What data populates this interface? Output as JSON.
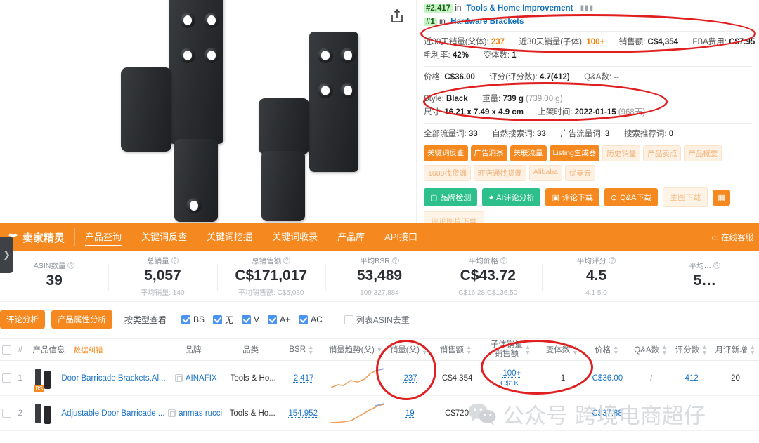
{
  "product_panel": {
    "share_icon": "share-icon",
    "rank_main": {
      "badge": "#2,417",
      "prefix": "in",
      "category": "Tools & Home Improvement"
    },
    "rank_sub": {
      "badge": "#1",
      "prefix": "in",
      "category": "Hardware Brackets"
    },
    "metrics_line1": {
      "sales30_parent_label": "近30天销量(父体):",
      "sales30_parent_value": "237",
      "sales30_child_label": "近30天销量(子体):",
      "sales30_child_value": "100+",
      "revenue_label": "销售额:",
      "revenue_value": "C$4,354",
      "fba_label": "FBA费用:",
      "fba_value": "C$7.95"
    },
    "metrics_line2": {
      "margin_label": "毛利率:",
      "margin_value": "42%",
      "variants_label": "变体数:",
      "variants_value": "1"
    },
    "metrics_line3": {
      "price_label": "价格:",
      "price_value": "C$36.00",
      "rating_label": "评分(评分数):",
      "rating_value": "4.7(412)",
      "qa_label": "Q&A数:",
      "qa_value": "--"
    },
    "attr_line1": {
      "style_label": "Style:",
      "style_value": "Black",
      "weight_label": "重量:",
      "weight_value": "739 g",
      "weight_sub": "(739.00 g)"
    },
    "attr_line2": {
      "dim_label": "尺寸:",
      "dim_value": "16.21 x 7.49 x 4.9 cm",
      "listed_label": "上架时间:",
      "listed_value": "2022-01-15",
      "listed_sub": "(968天)"
    },
    "traffic": {
      "all_label": "全部流量词:",
      "all_value": "33",
      "organic_label": "自然搜索词:",
      "organic_value": "33",
      "ads_label": "广告流量词:",
      "ads_value": "3",
      "rec_label": "搜索推荐词:",
      "rec_value": "0"
    },
    "chips": [
      {
        "label": "关键词反查",
        "style": "solid"
      },
      {
        "label": "广告洞察",
        "style": "solid"
      },
      {
        "label": "关联流量",
        "style": "solid"
      },
      {
        "label": "Listing生成器",
        "style": "solid"
      },
      {
        "label": "历史销量",
        "style": "ghost"
      },
      {
        "label": "产品卖点",
        "style": "ghost"
      },
      {
        "label": "产品概要",
        "style": "ghost"
      },
      {
        "label": "1688找货源",
        "style": "ghost"
      },
      {
        "label": "旺店通找货源",
        "style": "ghost"
      },
      {
        "label": "Alibaba",
        "style": "ghost"
      },
      {
        "label": "优麦云",
        "style": "ghost"
      }
    ],
    "buttons": [
      {
        "label": "品牌检测",
        "style": "green",
        "icon": "square-icon"
      },
      {
        "label": "AI评论分析",
        "style": "green",
        "icon": "pie-icon"
      },
      {
        "label": "评论下载",
        "style": "orange",
        "icon": "comment-icon"
      },
      {
        "label": "Q&A下载",
        "style": "orange",
        "icon": "question-icon"
      },
      {
        "label": "主图下载",
        "style": "pale",
        "icon": ""
      },
      {
        "label": "",
        "style": "square",
        "icon": "grid-icon"
      }
    ],
    "buttons_row2": [
      {
        "label": "评论图片下载",
        "style": "pale",
        "icon": ""
      }
    ]
  },
  "navbar": {
    "brand": "卖家精灵",
    "brand_logo": "sprite-logo",
    "tabs": [
      {
        "label": "产品查询",
        "active": true
      },
      {
        "label": "关键词反查",
        "active": false
      },
      {
        "label": "关键词挖掘",
        "active": false
      },
      {
        "label": "关键词收录",
        "active": false
      },
      {
        "label": "产品库",
        "active": false
      },
      {
        "label": "API接口",
        "active": false
      }
    ],
    "right_label": "在线客服"
  },
  "sidebar_toggle": {
    "icon": "chevron-right-icon"
  },
  "stats": [
    {
      "label": "ASIN数量",
      "value": "39",
      "sub": ""
    },
    {
      "label": "总销量",
      "value": "5,057",
      "sub": "平均销量: 140"
    },
    {
      "label": "总销售额",
      "value": "C$171,017",
      "sub": "平均销售额: C$5,030"
    },
    {
      "label": "平均BSR",
      "value": "53,489",
      "sub": "109  327,884"
    },
    {
      "label": "平均价格",
      "value": "C$43.72",
      "sub": "C$16.28  C$136.50"
    },
    {
      "label": "平均评分",
      "value": "4.5",
      "sub": "4.1  5.0"
    },
    {
      "label": "平均…",
      "value": "5…",
      "sub": ""
    }
  ],
  "filters": {
    "buttons": [
      {
        "label": "评论分析"
      },
      {
        "label": "产品属性分析"
      }
    ],
    "view_by_type_label": "按类型查看",
    "checkboxes": [
      {
        "label": "BS",
        "checked": true
      },
      {
        "label": "无",
        "checked": true
      },
      {
        "label": "V",
        "checked": true
      },
      {
        "label": "A+",
        "checked": true
      },
      {
        "label": "AC",
        "checked": true
      }
    ],
    "dedupe": {
      "label": "列表ASIN去重",
      "checked": false
    }
  },
  "table": {
    "headers": {
      "index": "#",
      "product_info": "产品信息",
      "product_info_tag": "数据纠错",
      "brand": "品牌",
      "category": "品类",
      "bsr": "BSR",
      "trend": "销量趋势(父)",
      "sales_parent": "销量(父)",
      "revenue": "销售额",
      "child_sales_l1": "子体销量",
      "child_sales_l2": "销售额",
      "variants": "变体数",
      "price": "价格",
      "qa": "Q&A数",
      "ratings": "评分数",
      "monthly_new": "月评新增"
    },
    "rows": [
      {
        "index": "1",
        "title": "Door Barricade Brackets,Al...",
        "badge": "BS",
        "brand": "AINAFIX",
        "category": "Tools & Ho...",
        "bsr": "2,417",
        "sales_parent": "237",
        "revenue": "C$4,354",
        "child_sales": "100+",
        "child_revenue": "C$1K+",
        "variants": "1",
        "price": "C$36.00",
        "qa": "/",
        "ratings": "412",
        "monthly_new": "20"
      },
      {
        "index": "2",
        "title": "Adjustable Door Barricade ...",
        "badge": "",
        "brand": "anmas rucci",
        "category": "Tools & Ho...",
        "bsr": "154,952",
        "sales_parent": "19",
        "revenue": "C$720",
        "child_sales": "",
        "child_revenue": "",
        "variants": "",
        "price": "C$37.88",
        "qa": "",
        "ratings": "",
        "monthly_new": ""
      }
    ]
  },
  "watermark": {
    "text": "公众号 跨境电商超仔",
    "logo": "wechat-logo"
  },
  "colors": {
    "brand_orange": "#f5891f",
    "green": "#2ec08c",
    "link_blue": "#1a73c8",
    "annotation_red": "#e02020",
    "rank_badge_green": "#c6f6c6"
  }
}
